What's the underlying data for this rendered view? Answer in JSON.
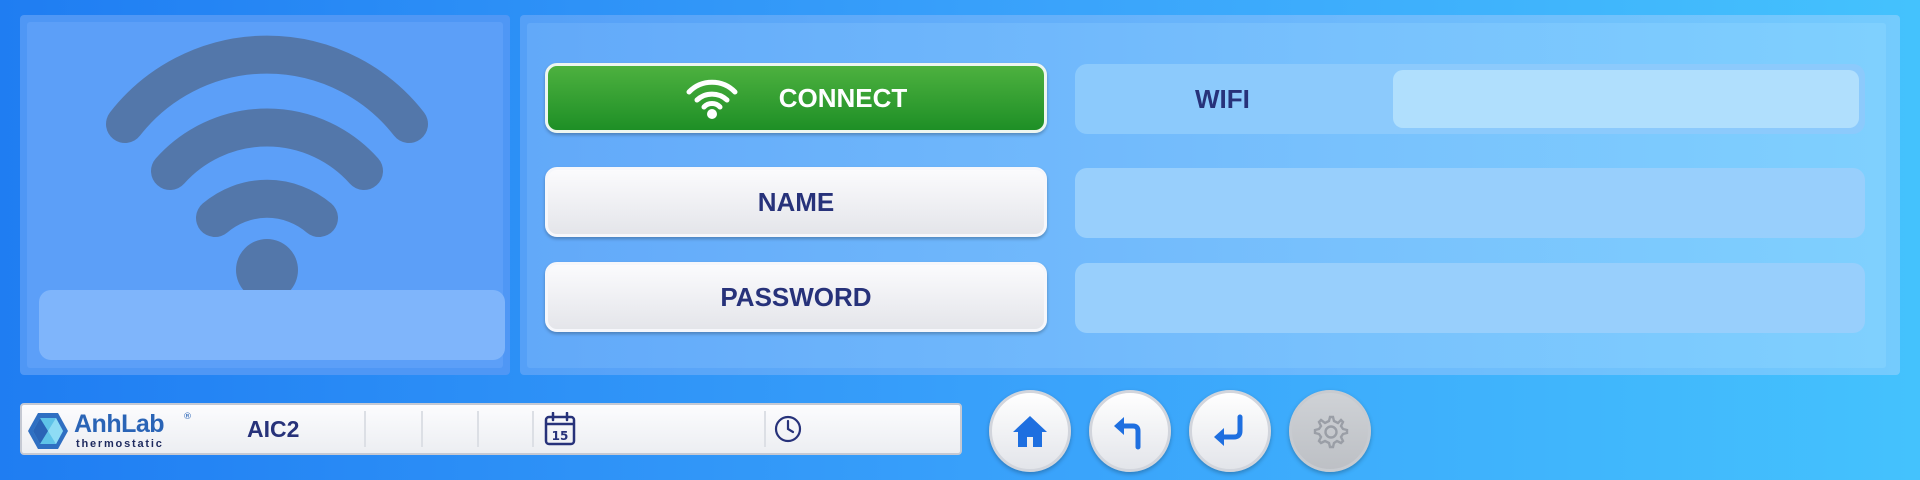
{
  "colors": {
    "accent_navy": "#27327a",
    "connect_green": "#2a9b2f",
    "icon_blue": "#2a64b6",
    "wifi_icon_gray": "#5377aa"
  },
  "left_panel": {
    "icon": "wifi-icon",
    "status_text": ""
  },
  "actions": {
    "connect_label": "CONNECT",
    "connect_icon": "wifi-icon",
    "name_label": "NAME",
    "password_label": "PASSWORD"
  },
  "fields": {
    "wifi_label": "WIFI",
    "wifi_value": "",
    "name_value": "",
    "password_value": ""
  },
  "statusbar": {
    "logo_name": "AnhLab",
    "logo_reg": "®",
    "logo_sub": "thermostatic",
    "device_name": "AIC2",
    "calendar_icon": "calendar-icon",
    "calendar_day": "15",
    "date_text": "",
    "clock_icon": "clock-icon",
    "time_text": ""
  },
  "nav": {
    "home_icon": "home-icon",
    "back_icon": "back-icon",
    "enter_icon": "enter-icon",
    "settings_icon": "gear-icon"
  }
}
